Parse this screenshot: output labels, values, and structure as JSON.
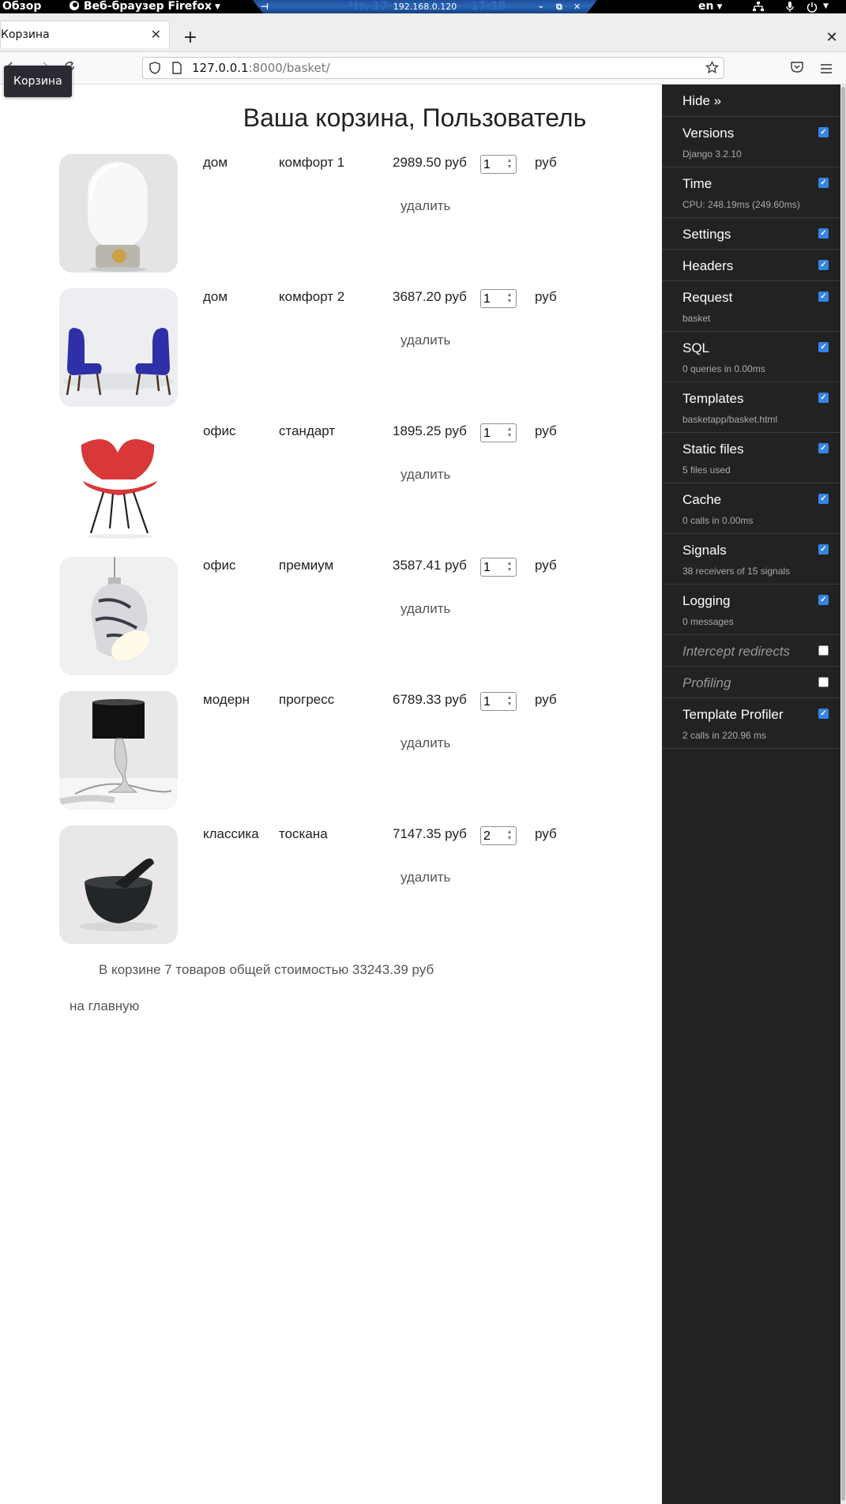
{
  "topbar": {
    "activities": "Обзор",
    "app_menu": "Веб-браузер Firefox",
    "remote_ip": "192.168.0.120",
    "clock_ghost_left": "Чт, 17",
    "clock_ghost_right": "17:18",
    "language": "en",
    "icons": [
      "firefox-icon",
      "pin-icon",
      "minimize-icon",
      "restore-icon",
      "close-icon",
      "network-icon",
      "microphone-icon",
      "power-icon"
    ]
  },
  "browser": {
    "tab_title": "Корзина",
    "new_tab": "+",
    "close_window": "✕",
    "url_host": "127.0.0.1",
    "url_rest": ":8000/basket/",
    "tooltip": "Корзина",
    "icons": [
      "back-icon",
      "forward-icon",
      "reload-icon",
      "shield-icon",
      "page-icon",
      "bookmark-star-icon",
      "pocket-icon",
      "menu-icon"
    ]
  },
  "page": {
    "heading": "Ваша корзина, Пользователь",
    "currency": "руб",
    "remove_label": "удалить",
    "summary": "В корзине 7 товаров общей стоимостью 33243.39 руб",
    "home_link": "на главную",
    "items": [
      {
        "category": "дом",
        "name": "комфорт 1",
        "price": "2989.50 руб",
        "qty": "1",
        "image": "white-egg-lamp"
      },
      {
        "category": "дом",
        "name": "комфорт 2",
        "price": "3687.20 руб",
        "qty": "1",
        "image": "two-blue-armchairs"
      },
      {
        "category": "офис",
        "name": "стандарт",
        "price": "1895.25 руб",
        "qty": "1",
        "image": "red-shell-chair"
      },
      {
        "category": "офис",
        "name": "премиум",
        "price": "3587.41 руб",
        "qty": "1",
        "image": "marble-pendant-lamp"
      },
      {
        "category": "модерн",
        "name": "прогресс",
        "price": "6789.33 руб",
        "qty": "1",
        "image": "black-shade-table-lamp"
      },
      {
        "category": "классика",
        "name": "тоскана",
        "price": "7147.35 руб",
        "qty": "2",
        "image": "black-mortar-and-pestle"
      }
    ]
  },
  "debug_toolbar": {
    "hide": "Hide »",
    "panels": [
      {
        "title": "Versions",
        "subtitle": "Django 3.2.10",
        "checked": true
      },
      {
        "title": "Time",
        "subtitle": "CPU: 248.19ms (249.60ms)",
        "checked": true
      },
      {
        "title": "Settings",
        "subtitle": "",
        "checked": true
      },
      {
        "title": "Headers",
        "subtitle": "",
        "checked": true
      },
      {
        "title": "Request",
        "subtitle": "basket",
        "checked": true
      },
      {
        "title": "SQL",
        "subtitle": "0 queries in 0.00ms",
        "checked": true
      },
      {
        "title": "Templates",
        "subtitle": "basketapp/basket.html",
        "checked": true
      },
      {
        "title": "Static files",
        "subtitle": "5 files used",
        "checked": true
      },
      {
        "title": "Cache",
        "subtitle": "0 calls in 0.00ms",
        "checked": true
      },
      {
        "title": "Signals",
        "subtitle": "38 receivers of 15 signals",
        "checked": true
      },
      {
        "title": "Logging",
        "subtitle": "0 messages",
        "checked": true
      },
      {
        "title": "Intercept redirects",
        "subtitle": "",
        "checked": false
      },
      {
        "title": "Profiling",
        "subtitle": "",
        "checked": false
      },
      {
        "title": "Template Profiler",
        "subtitle": "2 calls in 220.96 ms",
        "checked": true
      }
    ]
  },
  "colors": {
    "toolbar_bg": "#222222",
    "checkbox_on": "#3584e4",
    "remote_strip": "#2b66b8",
    "chair_red": "#d8383a",
    "armchair_blue": "#2f2fa8"
  }
}
